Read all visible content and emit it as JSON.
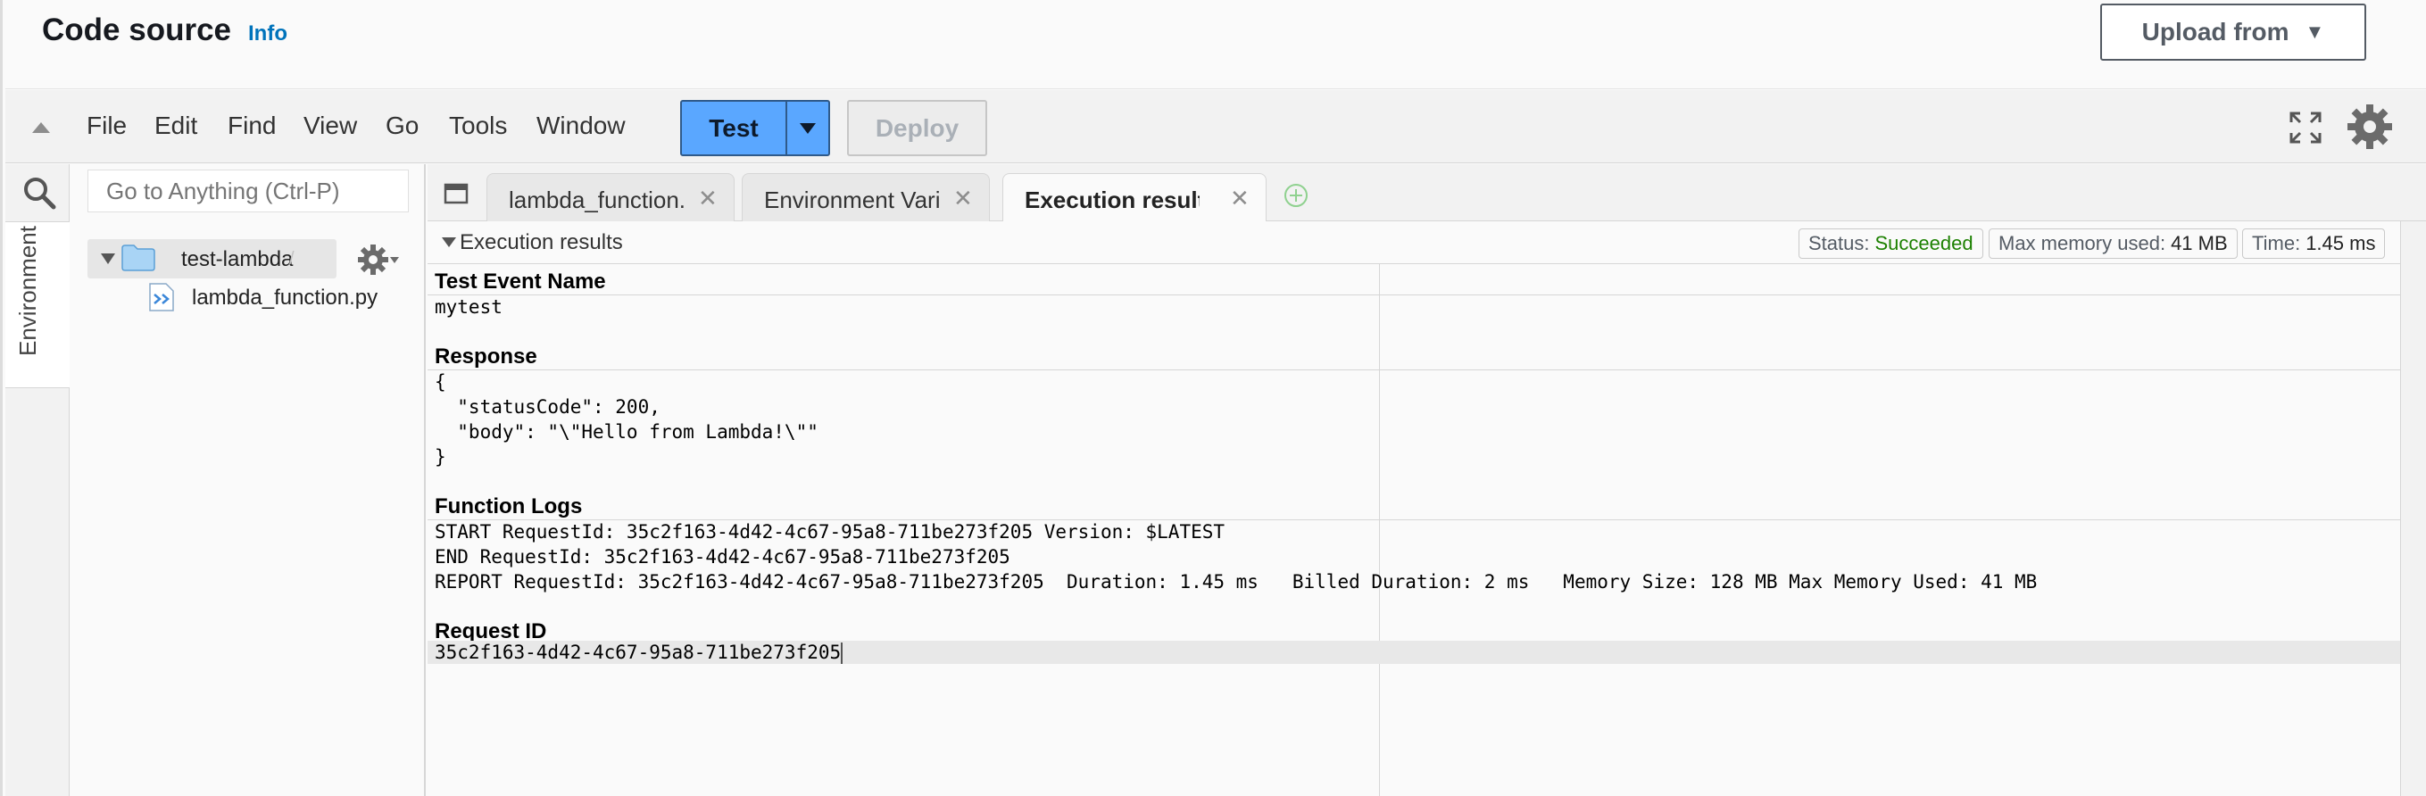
{
  "header": {
    "title": "Code source",
    "info_link": "Info",
    "upload_button": "Upload from"
  },
  "menubar": {
    "items": [
      "File",
      "Edit",
      "Find",
      "View",
      "Go",
      "Tools",
      "Window"
    ],
    "test_button": "Test",
    "deploy_button": "Deploy"
  },
  "sidebar": {
    "rail_tab": "Environment",
    "goto_placeholder": "Go to Anything (Ctrl-P)",
    "folder": "test-lambda",
    "folder_suffix": "/",
    "file": "lambda_function.py"
  },
  "tabs": [
    {
      "label": "lambda_function.",
      "active": false
    },
    {
      "label": "Environment Vari",
      "active": false
    },
    {
      "label": "Execution results",
      "active": true
    }
  ],
  "results": {
    "panel_title": "Execution results",
    "status_label": "Status:",
    "status_value": "Succeeded",
    "memory_label": "Max memory used:",
    "memory_value": "41 MB",
    "time_label": "Time:",
    "time_value": "1.45 ms",
    "test_event_title": "Test Event Name",
    "test_event_value": "mytest",
    "response_title": "Response",
    "response_lines": [
      "{",
      "  \"statusCode\": 200,",
      "  \"body\": \"\\\"Hello from Lambda!\\\"\"",
      "}"
    ],
    "logs_title": "Function Logs",
    "log_lines": [
      "START RequestId: 35c2f163-4d42-4c67-95a8-711be273f205 Version: $LATEST",
      "END RequestId: 35c2f163-4d42-4c67-95a8-711be273f205",
      "REPORT RequestId: 35c2f163-4d42-4c67-95a8-711be273f205  Duration: 1.45 ms   Billed Duration: 2 ms   Memory Size: 128 MB Max Memory Used: 41 MB"
    ],
    "request_id_title": "Request ID",
    "request_id_value": "35c2f163-4d42-4c67-95a8-711be273f205"
  },
  "colors": {
    "test_button": "#5aa7ff",
    "link": "#0073bb",
    "success": "#1d8102"
  },
  "icons": [
    "collapse-arrow-icon",
    "fullscreen-icon",
    "settings-gear-icon",
    "search-icon",
    "folder-icon",
    "python-file-icon",
    "tree-settings-icon",
    "tabs-menu-icon",
    "close-icon",
    "add-tab-icon"
  ]
}
